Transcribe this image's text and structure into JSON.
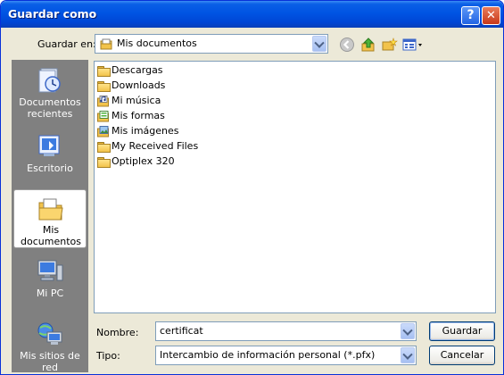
{
  "window": {
    "title": "Guardar como"
  },
  "location": {
    "label": "Guardar en:",
    "value": "Mis documentos"
  },
  "places": [
    {
      "label": "Documentos recientes",
      "icon": "recent-documents-icon"
    },
    {
      "label": "Escritorio",
      "icon": "desktop-icon"
    },
    {
      "label": "Mis documentos",
      "icon": "my-documents-icon"
    },
    {
      "label": "Mi PC",
      "icon": "my-computer-icon"
    },
    {
      "label": "Mis sitios de red",
      "icon": "network-places-icon"
    }
  ],
  "files": [
    {
      "name": "Descargas",
      "icon": "folder-icon"
    },
    {
      "name": "Downloads",
      "icon": "folder-icon"
    },
    {
      "name": "Mi música",
      "icon": "music-folder-icon"
    },
    {
      "name": "Mis formas",
      "icon": "forms-folder-icon"
    },
    {
      "name": "Mis imágenes",
      "icon": "pictures-folder-icon"
    },
    {
      "name": "My Received Files",
      "icon": "folder-icon"
    },
    {
      "name": "Optiplex 320",
      "icon": "folder-icon"
    }
  ],
  "filename": {
    "label": "Nombre:",
    "value": "certificat"
  },
  "filetype": {
    "label": "Tipo:",
    "value": "Intercambio de información personal (*.pfx)"
  },
  "buttons": {
    "save": "Guardar",
    "cancel": "Cancelar",
    "help": "?",
    "close": "✕"
  }
}
